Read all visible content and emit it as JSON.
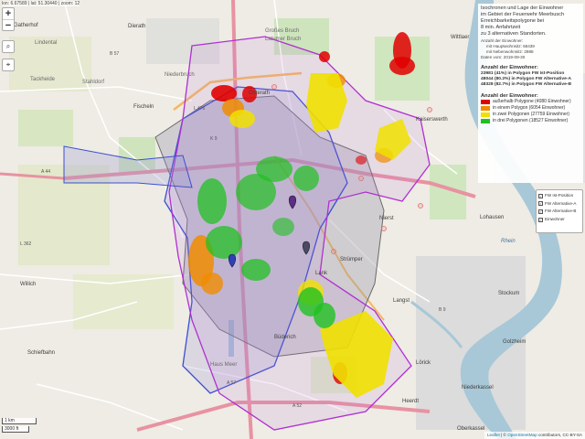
{
  "coords": {
    "text": "lon: 6.67589 | lat: 51.30440 | zoom: 12"
  },
  "zoom": {
    "in_label": "+",
    "out_label": "−"
  },
  "tools": {
    "search_glyph": "⌕",
    "reset_glyph": "⌖"
  },
  "info": {
    "title_lines": [
      "Isochronen und Lage der Einwohner",
      "im Gebiet der Feuerwehr Meerbusch",
      "Erreichbarkeitspolygone bei",
      "8 min. Anfahrtzeit",
      "zu 3 alternativen Standorten."
    ],
    "meta_label": "Anzahl der Einwohner:",
    "meta_main": "mit Hauptwohnsitz: 58439",
    "meta_second": "mit Nebenwohnsitz: 2988",
    "meta_date": "Daten vom: 2019-09-30",
    "polygon_head": "Anzahl der Einwohner:",
    "polygon_stats": [
      "23981 (41%) in Polygon FW Ist-Position",
      "48044 (80.2%) in Polygon FW Alternative-A",
      "48328 (82.7%) in Polygon FW Alternative-B"
    ],
    "legend_head": "Anzahl der Einwohner:",
    "legend": [
      {
        "label": "außerhalb Polygone (4080 Einwohner)",
        "color": "#e00000"
      },
      {
        "label": "in einem Polygon (6054 Einwohner)",
        "color": "#f08c00"
      },
      {
        "label": "in zwei Polygonen (27759 Einwohner)",
        "color": "#f0e000"
      },
      {
        "label": "in drei Polygonen (18527 Einwohner)",
        "color": "#20c020"
      }
    ]
  },
  "layers": [
    {
      "label": "FW Ist-Position",
      "checked": true
    },
    {
      "label": "FW Alternative-A",
      "checked": true
    },
    {
      "label": "FW Alternative-B",
      "checked": true
    },
    {
      "label": "Einwohner",
      "checked": true
    }
  ],
  "scale": {
    "km": "1 km",
    "ft": "3000 ft"
  },
  "attribution": {
    "leaflet": "Leaflet",
    "sep": " | © ",
    "osm": "OpenStreetMap",
    "rest": " contributors, CC-BY-SA"
  },
  "places": {
    "gatherhof": "Gatherhof",
    "lindental": "Lindental",
    "tackheide": "Tackheide",
    "stahldorf": "Stahldorf",
    "dierath": "Dierath",
    "niederbruch": "Niederbruch",
    "fischeln": "Fischeln",
    "osterath": "Osterath",
    "strumper": "Strümper",
    "schiefbahn": "Schiefbahn",
    "willich": "Willich",
    "lank": "Lank",
    "langst": "Langst",
    "nierst": "Nierst",
    "kaiserswerth": "Kaiserswerth",
    "wittlaer": "Wittlaer",
    "buderich": "Büderich",
    "lorick": "Lörick",
    "golzheim": "Golzheim",
    "heerdt": "Heerdt",
    "niederkassel": "Niederkassel",
    "oberkassel": "Oberkassel",
    "lohausen": "Lohausen",
    "stockum": "Stockum",
    "hausen": "Haus Meer",
    "rhein": "Rhein",
    "grosses_bruch": "Großes Bruch",
    "latumer": "Latumer Bruch"
  },
  "roads": {
    "a44": "A 44",
    "a57": "A 57",
    "a52": "A 52",
    "b57": "B 57",
    "l362": "L 362",
    "l476": "L 476",
    "k9": "K 9",
    "b9": "B 9"
  },
  "colors": {
    "red": "#e00000",
    "orange": "#f08c00",
    "yellow": "#f0e000",
    "green": "#20c020",
    "ist_polygon": "#3a4fd0",
    "alt_a_polygon": "#b030d0",
    "alt_b_polygon": "#6a6a6a",
    "water": "#a8c8d8",
    "motorway": "#e892a2"
  },
  "icons": {
    "zoom_in": "plus-icon",
    "zoom_out": "minus-icon",
    "search": "search-icon",
    "marker": "map-marker-icon",
    "checkbox": "checkbox-icon"
  }
}
